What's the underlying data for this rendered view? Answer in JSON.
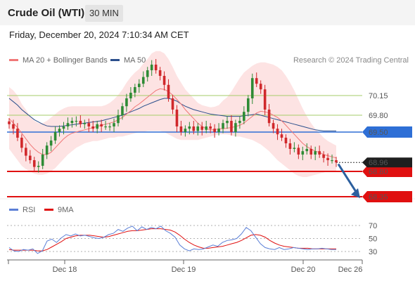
{
  "header": {
    "title": "Crude Oil (WTI)",
    "timeframe": "30 MIN"
  },
  "timestamp": "Friday, December 20, 2024 7:10:34 AM CET",
  "credit": "Research © 2024 Trading Central",
  "colors": {
    "up": "#2e8b35",
    "down": "#d0282b",
    "ma20": "#f07878",
    "ma50": "#2b4f8c",
    "bollinger_fill": "#fde0e0",
    "resistance": "#2e6fd6",
    "support": "#e01010",
    "pivot_lines": "#a6cc6a",
    "rsi": "#5b7fd6",
    "rsi_ma": "#e01010",
    "arrow": "#2c5f9e"
  },
  "chart_data": [
    {
      "type": "candlestick",
      "title": "Crude Oil (WTI)",
      "timeframe": "30 MIN",
      "ylim": [
        68.2,
        71.05
      ],
      "x_ticks": [
        "Dec 18",
        "Dec 19",
        "Dec 20",
        "Dec 26"
      ],
      "legend": [
        "MA 20 + Bollinger Bands",
        "MA 50"
      ],
      "legend_position": "top-left",
      "last_price": 68.96,
      "levels": [
        {
          "label": "70.15",
          "value": 70.15,
          "style": "pivot"
        },
        {
          "label": "69.80",
          "value": 69.8,
          "style": "pivot"
        },
        {
          "label": "69.50",
          "value": 69.5,
          "style": "resistance"
        },
        {
          "label": "68.80",
          "value": 68.8,
          "style": "support"
        },
        {
          "label": "68.35",
          "value": 68.35,
          "style": "support"
        }
      ],
      "close": [
        69.64,
        69.56,
        69.4,
        69.22,
        69.08,
        69.0,
        68.88,
        68.9,
        69.1,
        69.26,
        69.35,
        69.5,
        69.56,
        69.6,
        69.66,
        69.7,
        69.7,
        69.64,
        69.66,
        69.6,
        69.56,
        69.64,
        69.6,
        69.6,
        69.6,
        69.66,
        69.8,
        69.96,
        70.1,
        70.2,
        70.3,
        70.36,
        70.48,
        70.6,
        70.7,
        70.6,
        70.5,
        70.34,
        70.1,
        69.9,
        69.6,
        69.5,
        69.56,
        69.6,
        69.52,
        69.6,
        69.54,
        69.6,
        69.56,
        69.5,
        69.56,
        69.66,
        69.7,
        69.5,
        69.66,
        69.7,
        69.86,
        70.1,
        70.46,
        70.36,
        70.26,
        69.9,
        69.66,
        69.56,
        69.46,
        69.4,
        69.3,
        69.2,
        69.22,
        69.1,
        69.16,
        69.2,
        69.1,
        69.16,
        69.1,
        69.04,
        69.0,
        69.0,
        68.96
      ],
      "ma20": [
        69.74,
        69.66,
        69.58,
        69.48,
        69.38,
        69.28,
        69.2,
        69.14,
        69.1,
        69.1,
        69.14,
        69.22,
        69.3,
        69.38,
        69.44,
        69.48,
        69.5,
        69.52,
        69.54,
        69.56,
        69.58,
        69.6,
        69.62,
        69.64,
        69.66,
        69.68,
        69.72,
        69.76,
        69.82,
        69.88,
        69.95,
        70.0,
        70.06,
        70.12,
        70.18,
        70.24,
        70.27,
        70.26,
        70.22,
        70.16,
        70.08,
        70.0,
        69.9,
        69.82,
        69.74,
        69.66,
        69.6,
        69.56,
        69.54,
        69.54,
        69.56,
        69.56,
        69.57,
        69.58,
        69.6,
        69.62,
        69.66,
        69.72,
        69.78,
        69.84,
        69.87,
        69.86,
        69.84,
        69.8,
        69.76,
        69.7,
        69.62,
        69.54,
        69.46,
        69.38,
        69.3,
        69.24,
        69.2,
        69.16,
        69.14,
        69.1,
        69.08,
        69.06,
        69.04
      ],
      "ma50": [
        70.1,
        70.04,
        69.98,
        69.9,
        69.84,
        69.78,
        69.72,
        69.68,
        69.64,
        69.61,
        69.6,
        69.6,
        69.6,
        69.61,
        69.62,
        69.63,
        69.64,
        69.65,
        69.66,
        69.67,
        69.68,
        69.69,
        69.7,
        69.72,
        69.74,
        69.76,
        69.78,
        69.8,
        69.83,
        69.86,
        69.89,
        69.92,
        69.96,
        69.99,
        70.02,
        70.05,
        70.08,
        70.1,
        70.1,
        70.08,
        70.05,
        70.0,
        69.96,
        69.93,
        69.9,
        69.88,
        69.86,
        69.84,
        69.82,
        69.81,
        69.8,
        69.79,
        69.78,
        69.78,
        69.78,
        69.78,
        69.79,
        69.8,
        69.81,
        69.82,
        69.8,
        69.78,
        69.76,
        69.74,
        69.72,
        69.7,
        69.68,
        69.66,
        69.64,
        69.62,
        69.6,
        69.58,
        69.56,
        69.54,
        69.53,
        69.52,
        69.52,
        69.52,
        69.52
      ],
      "bb_upper": [
        70.3,
        70.24,
        70.15,
        70.0,
        69.9,
        69.78,
        69.7,
        69.66,
        69.66,
        69.7,
        69.76,
        69.82,
        69.88,
        69.92,
        69.95,
        69.96,
        69.96,
        69.96,
        69.96,
        69.96,
        69.96,
        69.96,
        69.96,
        69.98,
        70.02,
        70.08,
        70.16,
        70.26,
        70.38,
        70.48,
        70.56,
        70.62,
        70.72,
        70.8,
        70.9,
        70.94,
        70.94,
        70.9,
        70.8,
        70.66,
        70.5,
        70.38,
        70.26,
        70.18,
        70.1,
        70.02,
        69.98,
        69.96,
        69.94,
        69.95,
        69.98,
        70.06,
        70.12,
        70.22,
        70.34,
        70.46,
        70.56,
        70.62,
        70.68,
        70.72,
        70.74,
        70.74,
        70.72,
        70.7,
        70.66,
        70.6,
        70.5,
        70.38,
        70.24,
        70.08,
        69.92,
        69.78,
        69.66,
        69.56,
        69.48,
        69.4,
        69.34,
        69.3,
        69.26
      ],
      "bb_lower": [
        69.2,
        69.1,
        69.0,
        68.9,
        68.84,
        68.8,
        68.76,
        68.74,
        68.74,
        68.76,
        68.8,
        68.86,
        68.94,
        69.02,
        69.1,
        69.16,
        69.22,
        69.26,
        69.3,
        69.32,
        69.34,
        69.34,
        69.36,
        69.38,
        69.4,
        69.4,
        69.42,
        69.42,
        69.44,
        69.46,
        69.48,
        69.5,
        69.5,
        69.52,
        69.52,
        69.52,
        69.52,
        69.5,
        69.46,
        69.42,
        69.38,
        69.36,
        69.36,
        69.36,
        69.36,
        69.36,
        69.38,
        69.4,
        69.42,
        69.44,
        69.46,
        69.46,
        69.46,
        69.44,
        69.42,
        69.42,
        69.4,
        69.38,
        69.36,
        69.32,
        69.28,
        69.22,
        69.16,
        69.08,
        69.0,
        68.94,
        68.88,
        68.82,
        68.76,
        68.72,
        68.7,
        68.7,
        68.72,
        68.74,
        68.76,
        68.78,
        68.8,
        68.8,
        68.8
      ]
    },
    {
      "type": "line",
      "title": "RSI",
      "ylim": [
        10,
        80
      ],
      "y_ticks": [
        70,
        50,
        30
      ],
      "x_ticks": [
        "Dec 18",
        "Dec 19",
        "Dec 20",
        "Dec 26"
      ],
      "legend": [
        "RSI",
        "9MA"
      ],
      "legend_position": "top-left",
      "series": [
        {
          "name": "RSI",
          "values": [
            36,
            31,
            30,
            33,
            32,
            34,
            27,
            31,
            46,
            49,
            44,
            51,
            56,
            54,
            57,
            54,
            55,
            53,
            51,
            50,
            52,
            56,
            58,
            64,
            61,
            66,
            69,
            62,
            68,
            64,
            67,
            65,
            69,
            62,
            58,
            52,
            40,
            34,
            31,
            34,
            33,
            34,
            37,
            40,
            38,
            44,
            47,
            48,
            50,
            57,
            67,
            62,
            52,
            42,
            36,
            34,
            33,
            36,
            33,
            34,
            36,
            35,
            34,
            33,
            34,
            34,
            35,
            34,
            33,
            33
          ]
        },
        {
          "name": "9MA",
          "values": [
            33,
            32,
            32,
            32,
            32,
            32,
            31,
            31,
            33,
            37,
            41,
            45,
            50,
            52,
            54,
            55,
            55,
            55,
            54,
            53,
            52,
            53,
            55,
            57,
            59,
            61,
            62,
            62,
            63,
            64,
            65,
            65,
            65,
            64,
            63,
            60,
            55,
            49,
            44,
            40,
            37,
            35,
            35,
            36,
            37,
            38,
            40,
            42,
            44,
            47,
            51,
            55,
            56,
            55,
            52,
            47,
            43,
            40,
            38,
            37,
            36,
            35,
            35,
            35,
            34,
            34,
            34,
            34,
            34,
            34
          ]
        }
      ]
    }
  ]
}
